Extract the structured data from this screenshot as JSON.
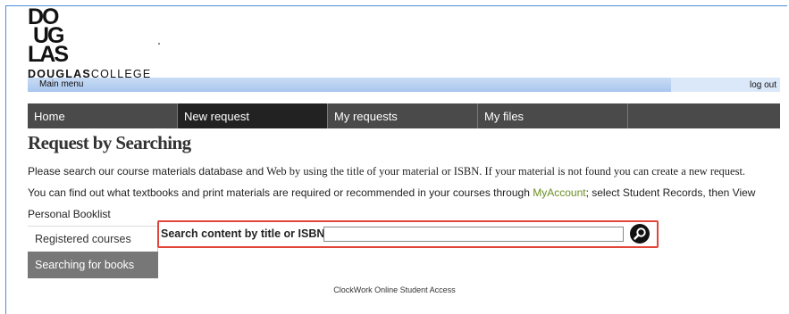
{
  "logo": {
    "mark_lines": [
      "DO",
      "UG",
      "LAS"
    ],
    "wordmark_bold": "DOUGLAS",
    "wordmark_light": "COLLEGE"
  },
  "menubar": {
    "main_menu": "Main menu",
    "log_out": "log out"
  },
  "nav": {
    "tabs": [
      {
        "label": "Home"
      },
      {
        "label": "New request"
      },
      {
        "label": "My requests"
      },
      {
        "label": "My files"
      }
    ]
  },
  "page": {
    "title": "Request by Searching",
    "line1_a": "Please search our course materials database ",
    "line1_b": "and",
    "line1_c": " Web by using the title of your material or ISBN. If your material is not found you can create a new request.",
    "line2_a": "You can find out what textbooks and print materials are required or recommended in your courses through ",
    "line2_link": "MyAccount",
    "line2_b": "; select Student Records, then View",
    "line3": "Personal Booklist"
  },
  "side": {
    "items": [
      {
        "label": "Registered courses"
      },
      {
        "label": "Searching for books"
      }
    ]
  },
  "search": {
    "label": "Search content by title or ISBN",
    "value": "",
    "button_icon": "search-icon"
  },
  "footer": {
    "text": "ClockWork Online Student Access"
  }
}
